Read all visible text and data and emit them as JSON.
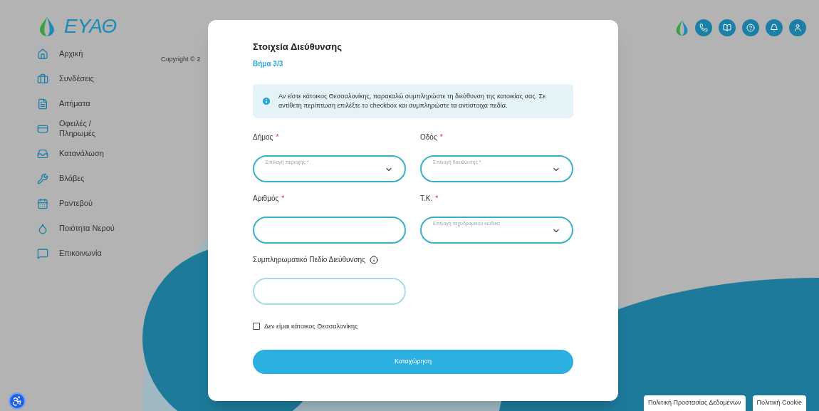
{
  "sidebar": {
    "items": [
      {
        "label": "Αρχική"
      },
      {
        "label": "Συνδέσεις"
      },
      {
        "label": "Αιτήματα"
      },
      {
        "label": "Οφειλές / Πληρωμές"
      },
      {
        "label": "Κατανάλωση"
      },
      {
        "label": "Βλάβες"
      },
      {
        "label": "Ραντεβού"
      },
      {
        "label": "Ποιότητα Νερού"
      },
      {
        "label": "Επικοινωνία"
      }
    ]
  },
  "logo": "ΕΥΑΘ",
  "copyright": "Copyright © 2",
  "modal": {
    "title": "Στοιχεία Διεύθυνσης",
    "step": "Βήμα 3/3",
    "info": "Αν είστε κάτοικος Θεσσαλονίκης, παρακαλώ συμπληρώστε τη διεύθυνση της κατοικίας σας. Σε αντίθετη περίπτωση επιλέξτε το checkbox και συμπληρώστε τα αντίστοιχα πεδία.",
    "fields": [
      {
        "label": "Δήμος",
        "mark": "*",
        "kind": "select",
        "placeholder": "Επιλογή περιοχής *"
      },
      {
        "label": "Οδός",
        "mark": "*",
        "kind": "select",
        "placeholder": "Επιλογή διεύθυνσης *"
      },
      {
        "label": "Αριθμός",
        "mark": "*",
        "kind": "text"
      },
      {
        "label": "Τ.Κ.",
        "mark": "*",
        "kind": "select",
        "placeholder": "Επιλογή ταχυδρομικού κώδικα"
      },
      {
        "label": "Συμπληρωματικό Πεδίο Διεύθυνσης",
        "kind": "text",
        "info_icon": true
      }
    ],
    "checkbox": {
      "label": "Δεν είμαι κάτοικος Θεσσαλονίκης",
      "checked": false
    },
    "submit": "Καταχώρηση"
  },
  "footer_links": [
    "Πολιτική Προστασίας Δεδομένων",
    "Πολιτική Cookie"
  ]
}
